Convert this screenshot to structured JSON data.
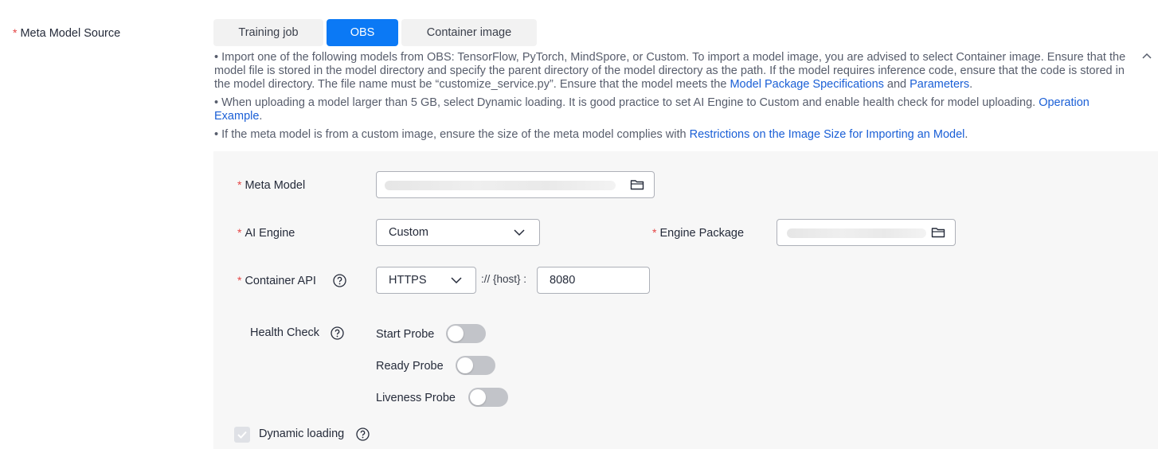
{
  "source": {
    "label": "Meta Model Source",
    "tabs": [
      {
        "label": "Training job",
        "active": false
      },
      {
        "label": "OBS",
        "active": true
      },
      {
        "label": "Container image",
        "active": false
      }
    ]
  },
  "notes": {
    "n1_text": "• Import one of the following models from OBS: TensorFlow, PyTorch, MindSpore, or Custom. To import a model image, you are advised to select Container image. Ensure that the model file is stored in the model directory and specify the parent directory of the model directory as the path. If the model requires inference code, ensure that the code is stored in the model directory. The file name must be “customize_service.py”. Ensure that the model meets the ",
    "n1_link1": "Model Package Specifications",
    "n1_and": " and ",
    "n1_link2": "Parameters",
    "n1_end": ".",
    "n2_text": "• When uploading a model larger than 5 GB, select Dynamic loading. It is good practice to set AI Engine to Custom and enable health check for model uploading. ",
    "n2_link": "Operation Example",
    "n2_end": ".",
    "n3_text": "• If the meta model is from a custom image, ensure the size of the meta model complies with ",
    "n3_link": "Restrictions on the Image Size for Importing an Model",
    "n3_end": "."
  },
  "form": {
    "meta_model_label": "Meta Model",
    "ai_engine_label": "AI Engine",
    "ai_engine_value": "Custom",
    "engine_package_label": "Engine Package",
    "container_api_label": "Container API",
    "protocol_value": "HTTPS",
    "host_sep": ":// {host} :",
    "port_value": "8080",
    "health_check_label": "Health Check",
    "start_probe_label": "Start Probe",
    "ready_probe_label": "Ready Probe",
    "liveness_probe_label": "Liveness Probe",
    "dynamic_loading_label": "Dynamic loading",
    "probes_enabled": [
      false,
      false,
      false
    ],
    "dynamic_loading_checked": true
  },
  "colors": {
    "accent": "#0b79f5",
    "required_star": "#e54545",
    "link": "#1a5fd6",
    "panel_bg": "#f7f7f7"
  },
  "icons": [
    "folder-icon",
    "chevron-down-icon",
    "help-icon",
    "chevron-up-icon",
    "check-icon"
  ]
}
